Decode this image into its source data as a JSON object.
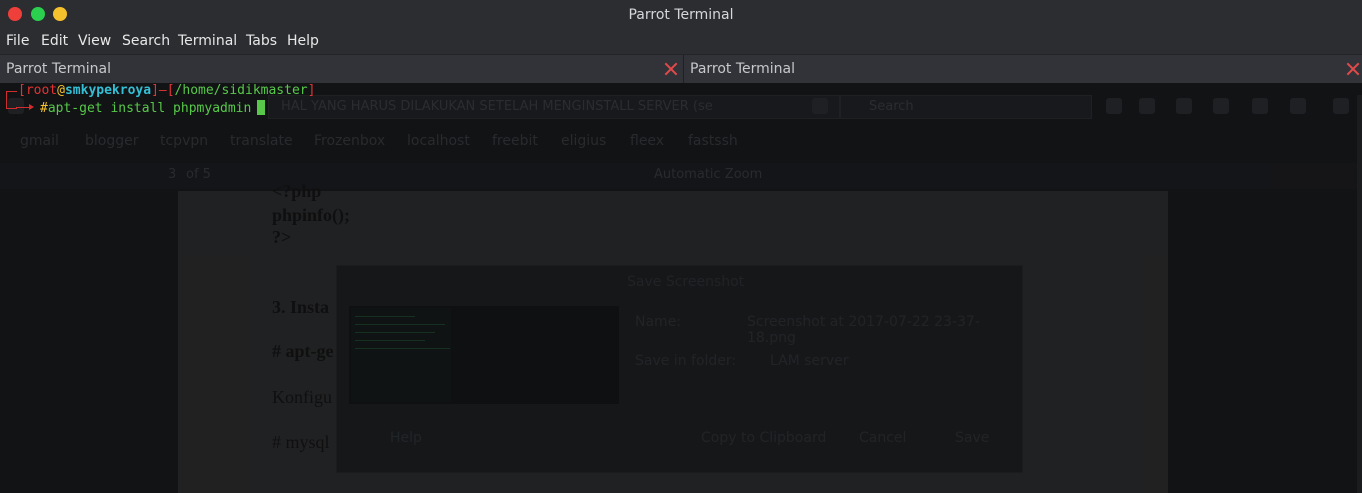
{
  "window": {
    "title": "Parrot Terminal"
  },
  "menu": [
    "File",
    "Edit",
    "View",
    "Search",
    "Terminal",
    "Tabs",
    "Help"
  ],
  "tabs": [
    {
      "label": "Parrot Terminal"
    },
    {
      "label": "Parrot Terminal"
    }
  ],
  "terminal": {
    "user": "root",
    "at": "@",
    "host": "smkypekroya",
    "path": "/home/sidikmaster",
    "prompt": "#",
    "command": "apt-get install phpmyadmin",
    "open_bracket": "[",
    "close_bracket": "]",
    "dash": "—",
    "path_open": "[",
    "path_close": "]"
  },
  "background": {
    "url": "HAL YANG HARUS DILAKUKAN SETELAH MENGINSTALL SERVER (se",
    "search_placeholder": "Search",
    "bookmarks": [
      "gmail",
      "blogger",
      "tcpvpn",
      "translate",
      "Frozenbox",
      "localhost",
      "freebit",
      "eligius",
      "fleex",
      "fastssh"
    ],
    "pdf": {
      "page_current": "3",
      "page_total": "of 5",
      "zoom": "Automatic Zoom",
      "lines": [
        "<?php",
        "phpinfo();",
        "?>",
        "3. Insta",
        "# apt-ge",
        "Konfigu",
        "# mysql"
      ]
    },
    "dialog": {
      "title": "Save Screenshot",
      "name_label": "Name:",
      "name_value": "Screenshot at 2017-07-22 23-37-18.png",
      "folder_label": "Save in folder:",
      "folder_value": "LAM server",
      "help": "Help",
      "copy": "Copy to Clipboard",
      "cancel": "Cancel",
      "save": "Save"
    }
  },
  "colors": {
    "accent_red": "#e23434",
    "prompt_green": "#57c84a",
    "host_cyan": "#34bfd6",
    "prompt_yellow": "#f5c12c"
  }
}
